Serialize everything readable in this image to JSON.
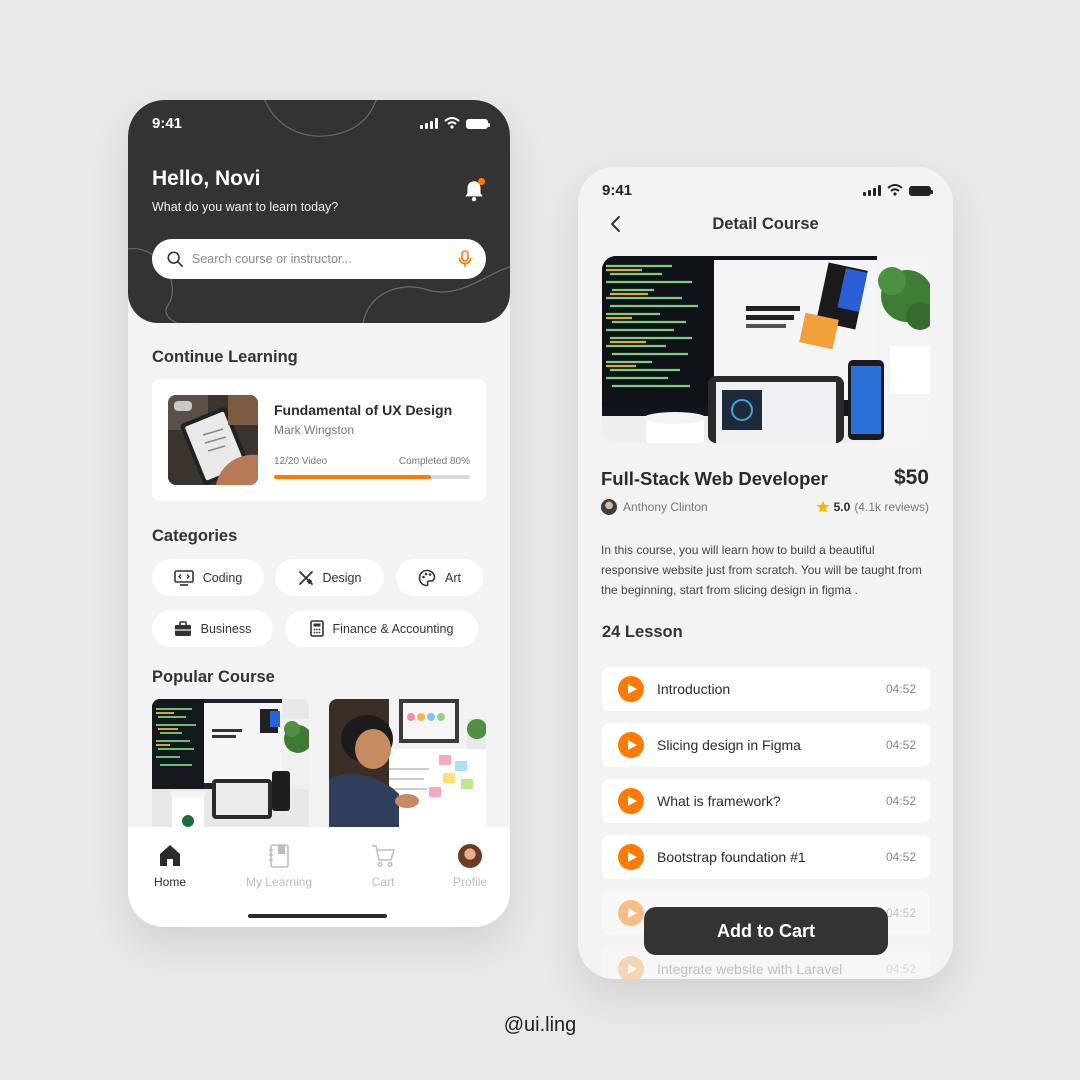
{
  "home": {
    "status_time": "9:41",
    "greeting": "Hello, Novi",
    "subgreeting": "What do you want to learn today?",
    "search_placeholder": "Search course or instructor...",
    "continue_section": "Continue Learning",
    "continue_card": {
      "title": "Fundamental of UX Design",
      "author": "Mark Wingston",
      "video_progress": "12/20 Video",
      "completed": "Completed 80%",
      "progress_fraction": 0.8
    },
    "categories_section": "Categories",
    "categories": [
      {
        "label": "Coding",
        "icon": "code-monitor-icon"
      },
      {
        "label": "Design",
        "icon": "design-tools-icon"
      },
      {
        "label": "Art",
        "icon": "palette-icon"
      },
      {
        "label": "Business",
        "icon": "briefcase-icon"
      },
      {
        "label": "Finance & Accounting",
        "icon": "calculator-icon"
      }
    ],
    "popular_section": "Popular Course",
    "nav": [
      {
        "label": "Home",
        "icon": "home-icon",
        "active": true
      },
      {
        "label": "My Learning",
        "icon": "notebook-icon",
        "active": false
      },
      {
        "label": "Cart",
        "icon": "cart-icon",
        "active": false
      },
      {
        "label": "Profile",
        "icon": "avatar",
        "active": false
      }
    ]
  },
  "detail": {
    "status_time": "9:41",
    "header_title": "Detail Course",
    "course_name": "Full-Stack Web Developer",
    "price": "$50",
    "instructor": "Anthony Clinton",
    "rating_value": "5.0",
    "rating_count": "(4.1k reviews)",
    "description": "In this course, you will learn how to build a beautiful responsive website just from scratch. You will be taught from the beginning, start from slicing design in figma .",
    "lesson_count": "24 Lesson",
    "lessons": [
      {
        "title": "Introduction",
        "duration": "04:52"
      },
      {
        "title": "Slicing design in Figma",
        "duration": "04:52"
      },
      {
        "title": "What is framework?",
        "duration": "04:52"
      },
      {
        "title": "Bootstrap foundation #1",
        "duration": "04:52"
      },
      {
        "title": "",
        "duration": "04:52"
      },
      {
        "title": "Integrate website with Laravel",
        "duration": "04:52"
      }
    ],
    "cart_button": "Add to Cart"
  },
  "watermark": "@ui.ling",
  "colors": {
    "accent": "#ff7a00",
    "dark": "#333333",
    "background": "#e9e9e9",
    "star": "#f5b800"
  }
}
